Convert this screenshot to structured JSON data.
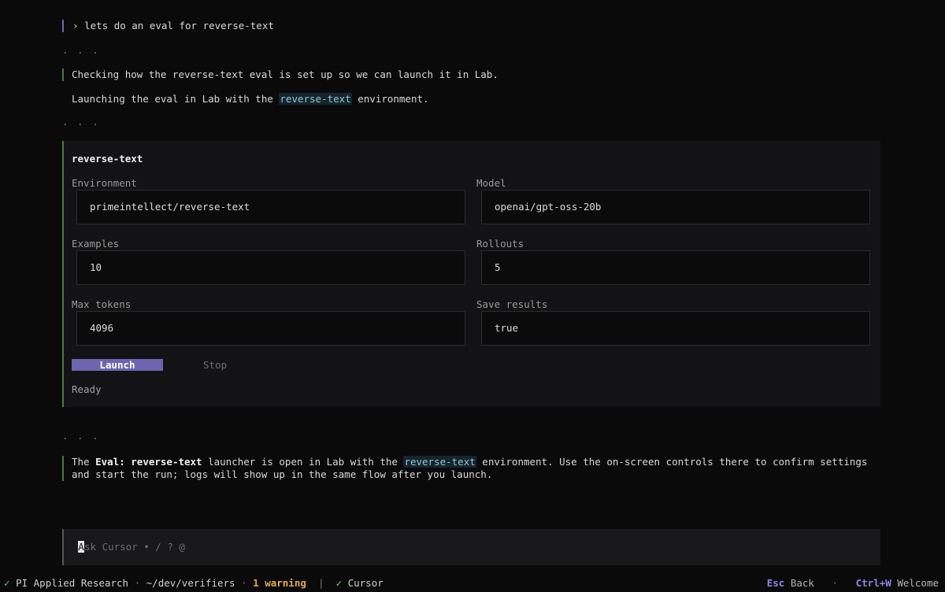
{
  "conversation": {
    "user_prompt": "lets do an eval for reverse-text",
    "prompt_marker": "›",
    "ellipsis": ". . .",
    "assistant_line_1": "Checking how the reverse-text eval is set up so we can launch it in Lab.",
    "assistant_line_2_prefix": "Launching the eval in Lab with the ",
    "assistant_line_2_highlight": "reverse-text",
    "assistant_line_2_suffix": " environment.",
    "final_prefix": "The ",
    "final_bold": "Eval: reverse-text",
    "final_mid": " launcher is open in Lab with the ",
    "final_highlight": "reverse-text",
    "final_suffix": " environment. Use the on-screen controls there to confirm settings and start the run; logs will show up in the same flow after you launch."
  },
  "card": {
    "title": "reverse-text",
    "fields": {
      "environment": {
        "label": "Environment",
        "value": "primeintellect/reverse-text"
      },
      "model": {
        "label": "Model",
        "value": "openai/gpt-oss-20b"
      },
      "examples": {
        "label": "Examples",
        "value": "10"
      },
      "rollouts": {
        "label": "Rollouts",
        "value": "5"
      },
      "max_tokens": {
        "label": "Max tokens",
        "value": "4096"
      },
      "save_results": {
        "label": "Save results",
        "value": "true"
      }
    },
    "launch_label": "Launch",
    "stop_label": "Stop",
    "status": "Ready"
  },
  "input": {
    "caret_char": "A",
    "placeholder_rest": "sk Cursor  •  /  ?  @"
  },
  "statusbar": {
    "check_icon": "✓",
    "workspace": "PI Applied Research",
    "path": "~/dev/verifiers",
    "warnings": "1 warning",
    "agent": "Cursor",
    "esc_key": "Esc",
    "esc_action": "Back",
    "ctrl_key": "Ctrl+W",
    "ctrl_action": "Welcome",
    "dot": "·",
    "pipe": "|"
  },
  "colors": {
    "background": "#0a0a0a",
    "accent": "#6c65b0",
    "assistant_bar": "#4a7a3a",
    "highlight_text": "#8ec8dc",
    "warning": "#e8a84f",
    "success": "#6fc56f"
  }
}
